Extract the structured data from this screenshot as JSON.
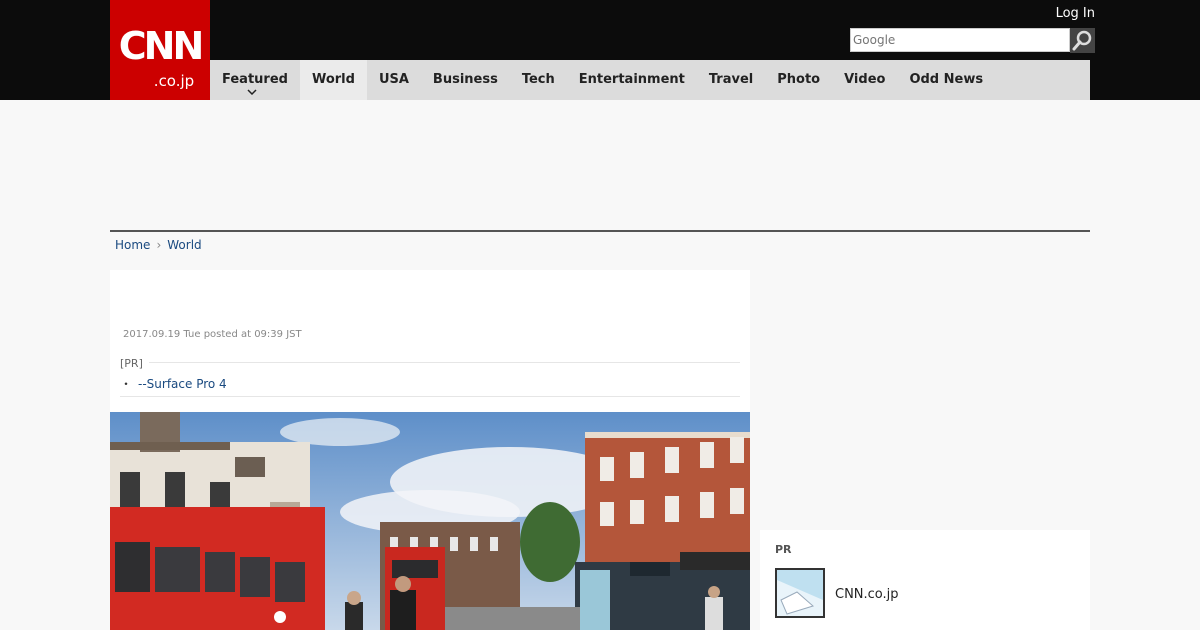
{
  "header": {
    "logo_main": "CNN",
    "logo_sub": ".co.jp",
    "login": "Log In",
    "search_placeholder": "Google"
  },
  "nav": {
    "items": [
      "Featured",
      "World",
      "USA",
      "Business",
      "Tech",
      "Entertainment",
      "Travel",
      "Photo",
      "Video",
      "Odd News"
    ],
    "active": "World"
  },
  "breadcrumb": {
    "home": "Home",
    "current": "World"
  },
  "article": {
    "date": "2017.09.19 Tue posted at 09:39 JST",
    "pr_label": "[PR]",
    "pr_link": "--Surface Pro 4"
  },
  "sidebar": {
    "pr_label": "PR",
    "item_name": "CNN.co.jp"
  },
  "colors": {
    "brand": "#cc0000",
    "link": "#1a4a80"
  }
}
